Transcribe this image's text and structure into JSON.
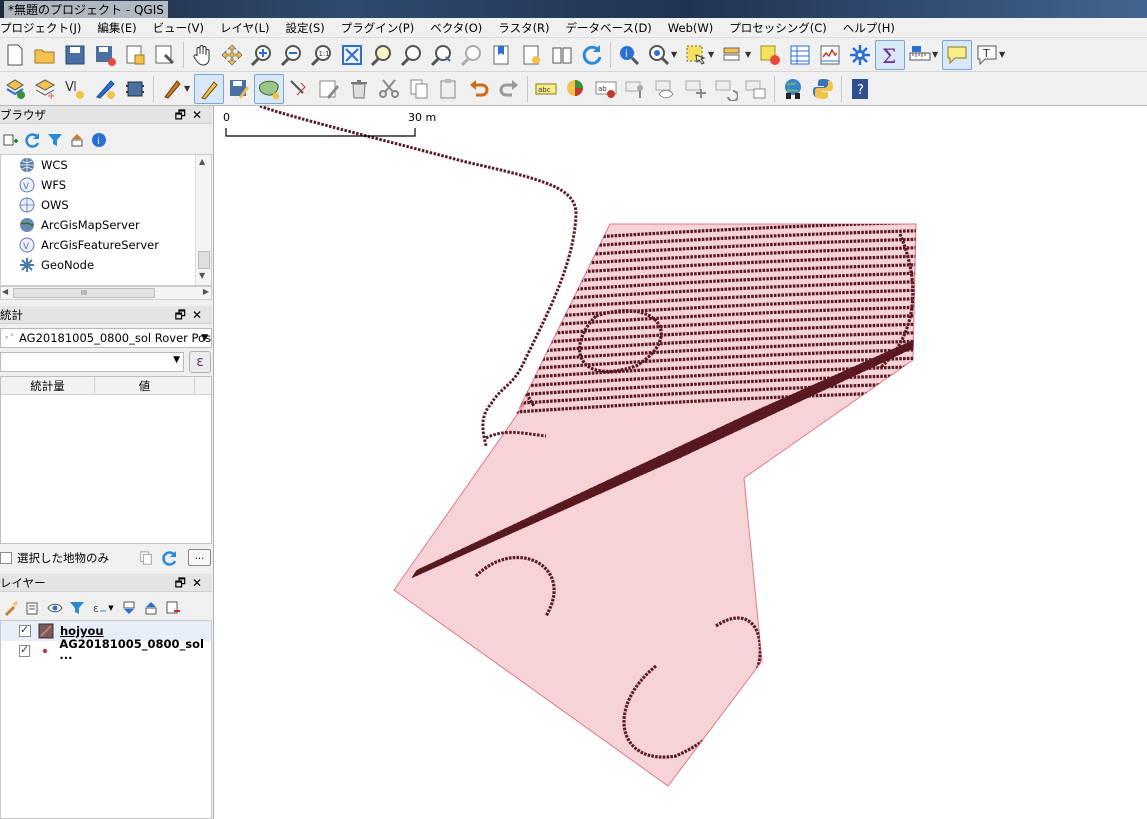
{
  "window": {
    "title": "*無題のプロジェクト - QGIS"
  },
  "menu": [
    "プロジェクト(J)",
    "編集(E)",
    "ビュー(V)",
    "レイヤ(L)",
    "設定(S)",
    "プラグイン(P)",
    "ベクタ(O)",
    "ラスタ(R)",
    "データベース(D)",
    "Web(W)",
    "プロセッシング(C)",
    "ヘルプ(H)"
  ],
  "browser_panel": {
    "title": "ブラウザ",
    "items": [
      "WCS",
      "WFS",
      "OWS",
      "ArcGisMapServer",
      "ArcGisFeatureServer",
      "GeoNode"
    ],
    "hscroll_label": "III"
  },
  "stats_panel": {
    "title": "統計",
    "layer": "AG20181005_0800_sol Rover Positi",
    "columns": [
      "統計量",
      "値"
    ],
    "selected_only_label": "選択した地物のみ",
    "more_label": "..."
  },
  "layers_panel": {
    "title": "レイヤー",
    "layers": [
      {
        "name": "hojyou",
        "checked": true,
        "type": "polygon"
      },
      {
        "name": "AG20181005_0800_sol ···",
        "checked": true,
        "type": "point"
      }
    ]
  },
  "map": {
    "scalebar": {
      "start_label": "0",
      "end_label": "30 m"
    },
    "colors": {
      "polygon_fill": "#f6d3d6",
      "polygon_stroke": "#e07a84",
      "track": "#5a1a22"
    }
  }
}
